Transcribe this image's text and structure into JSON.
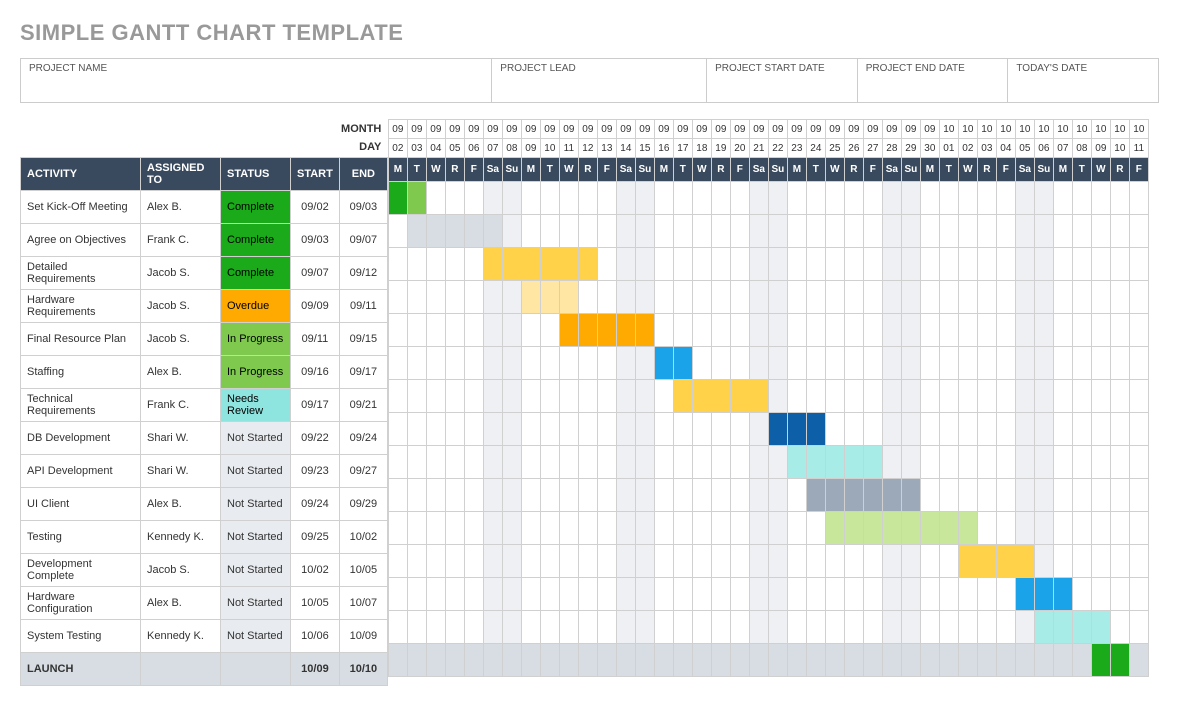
{
  "page_title": "SIMPLE GANTT CHART TEMPLATE",
  "meta": {
    "project_name_label": "PROJECT NAME",
    "project_lead_label": "PROJECT LEAD",
    "start_date_label": "PROJECT START DATE",
    "end_date_label": "PROJECT END DATE",
    "today_label": "TODAY'S DATE"
  },
  "hdr": {
    "month": "MONTH",
    "day": "DAY",
    "activity": "ACTIVITY",
    "assigned": "ASSIGNED TO",
    "status": "STATUS",
    "start": "START",
    "end": "END"
  },
  "statuses": {
    "Complete": {
      "bg": "#1aaa1a",
      "fg": "#000"
    },
    "Overdue": {
      "bg": "#ffaa00",
      "fg": "#000"
    },
    "In Progress": {
      "bg": "#7fc94f",
      "fg": "#000"
    },
    "Needs Review": {
      "bg": "#8ee5e0",
      "fg": "#000"
    },
    "Not Started": {
      "bg": "#e8ebef",
      "fg": "#333"
    }
  },
  "columns": [
    {
      "m": "09",
      "d": "02",
      "w": "M",
      "wk": false
    },
    {
      "m": "09",
      "d": "03",
      "w": "T",
      "wk": false
    },
    {
      "m": "09",
      "d": "04",
      "w": "W",
      "wk": false
    },
    {
      "m": "09",
      "d": "05",
      "w": "R",
      "wk": false
    },
    {
      "m": "09",
      "d": "06",
      "w": "F",
      "wk": false
    },
    {
      "m": "09",
      "d": "07",
      "w": "Sa",
      "wk": true
    },
    {
      "m": "09",
      "d": "08",
      "w": "Su",
      "wk": true
    },
    {
      "m": "09",
      "d": "09",
      "w": "M",
      "wk": false
    },
    {
      "m": "09",
      "d": "10",
      "w": "T",
      "wk": false
    },
    {
      "m": "09",
      "d": "11",
      "w": "W",
      "wk": false
    },
    {
      "m": "09",
      "d": "12",
      "w": "R",
      "wk": false
    },
    {
      "m": "09",
      "d": "13",
      "w": "F",
      "wk": false
    },
    {
      "m": "09",
      "d": "14",
      "w": "Sa",
      "wk": true
    },
    {
      "m": "09",
      "d": "15",
      "w": "Su",
      "wk": true
    },
    {
      "m": "09",
      "d": "16",
      "w": "M",
      "wk": false
    },
    {
      "m": "09",
      "d": "17",
      "w": "T",
      "wk": false
    },
    {
      "m": "09",
      "d": "18",
      "w": "W",
      "wk": false
    },
    {
      "m": "09",
      "d": "19",
      "w": "R",
      "wk": false
    },
    {
      "m": "09",
      "d": "20",
      "w": "F",
      "wk": false
    },
    {
      "m": "09",
      "d": "21",
      "w": "Sa",
      "wk": true
    },
    {
      "m": "09",
      "d": "22",
      "w": "Su",
      "wk": true
    },
    {
      "m": "09",
      "d": "23",
      "w": "M",
      "wk": false
    },
    {
      "m": "09",
      "d": "24",
      "w": "T",
      "wk": false
    },
    {
      "m": "09",
      "d": "25",
      "w": "W",
      "wk": false
    },
    {
      "m": "09",
      "d": "26",
      "w": "R",
      "wk": false
    },
    {
      "m": "09",
      "d": "27",
      "w": "F",
      "wk": false
    },
    {
      "m": "09",
      "d": "28",
      "w": "Sa",
      "wk": true
    },
    {
      "m": "09",
      "d": "29",
      "w": "Su",
      "wk": true
    },
    {
      "m": "09",
      "d": "30",
      "w": "M",
      "wk": false
    },
    {
      "m": "10",
      "d": "01",
      "w": "T",
      "wk": false
    },
    {
      "m": "10",
      "d": "02",
      "w": "W",
      "wk": false
    },
    {
      "m": "10",
      "d": "03",
      "w": "R",
      "wk": false
    },
    {
      "m": "10",
      "d": "04",
      "w": "F",
      "wk": false
    },
    {
      "m": "10",
      "d": "05",
      "w": "Sa",
      "wk": true
    },
    {
      "m": "10",
      "d": "06",
      "w": "Su",
      "wk": true
    },
    {
      "m": "10",
      "d": "07",
      "w": "M",
      "wk": false
    },
    {
      "m": "10",
      "d": "08",
      "w": "T",
      "wk": false
    },
    {
      "m": "10",
      "d": "09",
      "w": "W",
      "wk": false
    },
    {
      "m": "10",
      "d": "10",
      "w": "R",
      "wk": false
    },
    {
      "m": "10",
      "d": "11",
      "w": "F",
      "wk": false
    }
  ],
  "tasks": [
    {
      "activity": "Set Kick-Off Meeting",
      "assigned": "Alex B.",
      "status": "Complete",
      "start": "09/02",
      "end": "09/03",
      "bar": {
        "from": 0,
        "to": 1,
        "colors": [
          "#1aaa1a",
          "#7fc94f"
        ]
      }
    },
    {
      "activity": "Agree on Objectives",
      "assigned": "Frank C.",
      "status": "Complete",
      "start": "09/03",
      "end": "09/07",
      "bar": {
        "from": 1,
        "to": 5,
        "colors": [
          "#d8dde3",
          "#d8dde3",
          "#d8dde3",
          "#d8dde3",
          "#d8dde3"
        ]
      }
    },
    {
      "activity": "Detailed Requirements",
      "assigned": "Jacob S.",
      "status": "Complete",
      "start": "09/07",
      "end": "09/12",
      "bar": {
        "from": 5,
        "to": 10,
        "colors": [
          "#ffd24a",
          "#ffd24a",
          "#ffd24a",
          "#ffd24a",
          "#ffd24a",
          "#ffd24a"
        ]
      }
    },
    {
      "activity": "Hardware Requirements",
      "assigned": "Jacob S.",
      "status": "Overdue",
      "start": "09/09",
      "end": "09/11",
      "bar": {
        "from": 7,
        "to": 9,
        "colors": [
          "#ffe6a3",
          "#ffe6a3",
          "#ffe6a3"
        ]
      }
    },
    {
      "activity": "Final Resource Plan",
      "assigned": "Jacob S.",
      "status": "In Progress",
      "start": "09/11",
      "end": "09/15",
      "bar": {
        "from": 9,
        "to": 13,
        "colors": [
          "#ffaa00",
          "#ffaa00",
          "#ffaa00",
          "#ffaa00",
          "#ffaa00"
        ]
      }
    },
    {
      "activity": "Staffing",
      "assigned": "Alex B.",
      "status": "In Progress",
      "start": "09/16",
      "end": "09/17",
      "bar": {
        "from": 14,
        "to": 15,
        "colors": [
          "#1aa3e8",
          "#1aa3e8"
        ]
      }
    },
    {
      "activity": "Technical Requirements",
      "assigned": "Frank C.",
      "status": "Needs Review",
      "start": "09/17",
      "end": "09/21",
      "bar": {
        "from": 15,
        "to": 19,
        "colors": [
          "#ffd24a",
          "#ffd24a",
          "#ffd24a",
          "#ffd24a",
          "#ffd24a"
        ]
      }
    },
    {
      "activity": "DB Development",
      "assigned": "Shari W.",
      "status": "Not Started",
      "start": "09/22",
      "end": "09/24",
      "bar": {
        "from": 20,
        "to": 22,
        "colors": [
          "#0d5fa8",
          "#0d5fa8",
          "#0d5fa8"
        ]
      }
    },
    {
      "activity": "API Development",
      "assigned": "Shari W.",
      "status": "Not Started",
      "start": "09/23",
      "end": "09/27",
      "bar": {
        "from": 21,
        "to": 25,
        "colors": [
          "#a8ece8",
          "#a8ece8",
          "#a8ece8",
          "#a8ece8",
          "#a8ece8"
        ]
      }
    },
    {
      "activity": "UI Client",
      "assigned": "Alex B.",
      "status": "Not Started",
      "start": "09/24",
      "end": "09/29",
      "bar": {
        "from": 22,
        "to": 27,
        "colors": [
          "#9ca9b8",
          "#9ca9b8",
          "#9ca9b8",
          "#9ca9b8",
          "#9ca9b8",
          "#9ca9b8"
        ]
      }
    },
    {
      "activity": "Testing",
      "assigned": "Kennedy K.",
      "status": "Not Started",
      "start": "09/25",
      "end": "10/02",
      "bar": {
        "from": 23,
        "to": 30,
        "colors": [
          "#c9e79a",
          "#c9e79a",
          "#c9e79a",
          "#c9e79a",
          "#c9e79a",
          "#c9e79a",
          "#c9e79a",
          "#c9e79a"
        ]
      }
    },
    {
      "activity": "Development Complete",
      "assigned": "Jacob S.",
      "status": "Not Started",
      "start": "10/02",
      "end": "10/05",
      "bar": {
        "from": 30,
        "to": 33,
        "colors": [
          "#ffd24a",
          "#ffd24a",
          "#ffd24a",
          "#ffd24a"
        ]
      }
    },
    {
      "activity": "Hardware Configuration",
      "assigned": "Alex B.",
      "status": "Not Started",
      "start": "10/05",
      "end": "10/07",
      "bar": {
        "from": 33,
        "to": 35,
        "colors": [
          "#1aa3e8",
          "#1aa3e8",
          "#1aa3e8"
        ]
      }
    },
    {
      "activity": "System Testing",
      "assigned": "Kennedy K.",
      "status": "Not Started",
      "start": "10/06",
      "end": "10/09",
      "bar": {
        "from": 34,
        "to": 37,
        "colors": [
          "#a8ece8",
          "#a8ece8",
          "#a8ece8",
          "#a8ece8"
        ]
      }
    },
    {
      "activity": "LAUNCH",
      "assigned": "",
      "status": "",
      "start": "10/09",
      "end": "10/10",
      "bar": {
        "from": 37,
        "to": 38,
        "colors": [
          "#1aaa1a",
          "#1aaa1a"
        ]
      },
      "final": true
    }
  ],
  "chart_data": {
    "type": "gantt",
    "title": "Simple Gantt Chart Template",
    "x_axis": {
      "unit": "day",
      "start": "09/02",
      "end": "10/11",
      "columns": 40
    },
    "legend_statuses": [
      "Complete",
      "Overdue",
      "In Progress",
      "Needs Review",
      "Not Started"
    ],
    "series": [
      {
        "name": "Set Kick-Off Meeting",
        "assigned": "Alex B.",
        "status": "Complete",
        "start": "09/02",
        "end": "09/03"
      },
      {
        "name": "Agree on Objectives",
        "assigned": "Frank C.",
        "status": "Complete",
        "start": "09/03",
        "end": "09/07"
      },
      {
        "name": "Detailed Requirements",
        "assigned": "Jacob S.",
        "status": "Complete",
        "start": "09/07",
        "end": "09/12"
      },
      {
        "name": "Hardware Requirements",
        "assigned": "Jacob S.",
        "status": "Overdue",
        "start": "09/09",
        "end": "09/11"
      },
      {
        "name": "Final Resource Plan",
        "assigned": "Jacob S.",
        "status": "In Progress",
        "start": "09/11",
        "end": "09/15"
      },
      {
        "name": "Staffing",
        "assigned": "Alex B.",
        "status": "In Progress",
        "start": "09/16",
        "end": "09/17"
      },
      {
        "name": "Technical Requirements",
        "assigned": "Frank C.",
        "status": "Needs Review",
        "start": "09/17",
        "end": "09/21"
      },
      {
        "name": "DB Development",
        "assigned": "Shari W.",
        "status": "Not Started",
        "start": "09/22",
        "end": "09/24"
      },
      {
        "name": "API Development",
        "assigned": "Shari W.",
        "status": "Not Started",
        "start": "09/23",
        "end": "09/27"
      },
      {
        "name": "UI Client",
        "assigned": "Alex B.",
        "status": "Not Started",
        "start": "09/24",
        "end": "09/29"
      },
      {
        "name": "Testing",
        "assigned": "Kennedy K.",
        "status": "Not Started",
        "start": "09/25",
        "end": "10/02"
      },
      {
        "name": "Development Complete",
        "assigned": "Jacob S.",
        "status": "Not Started",
        "start": "10/02",
        "end": "10/05"
      },
      {
        "name": "Hardware Configuration",
        "assigned": "Alex B.",
        "status": "Not Started",
        "start": "10/05",
        "end": "10/07"
      },
      {
        "name": "System Testing",
        "assigned": "Kennedy K.",
        "status": "Not Started",
        "start": "10/06",
        "end": "10/09"
      },
      {
        "name": "LAUNCH",
        "assigned": "",
        "status": "",
        "start": "10/09",
        "end": "10/10"
      }
    ]
  }
}
